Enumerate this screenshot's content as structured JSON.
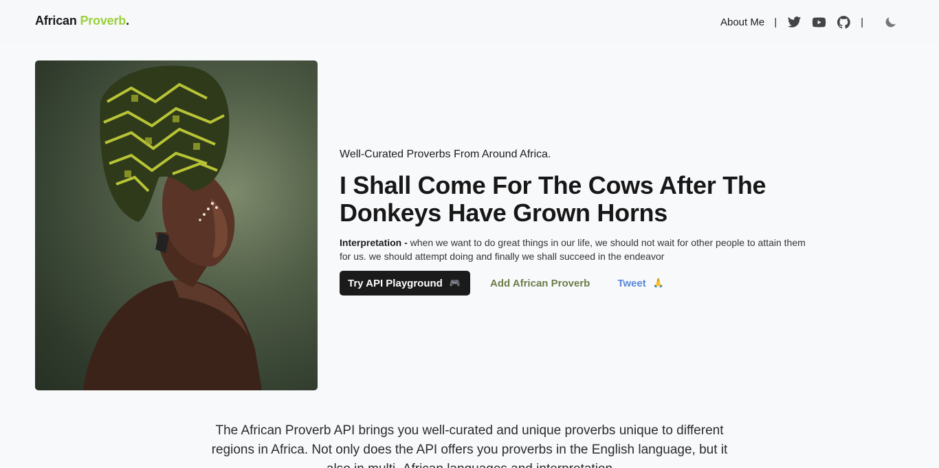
{
  "header": {
    "logo": {
      "part1": "African",
      "part2": "Proverb",
      "part3": "."
    },
    "nav": {
      "about_label": "About Me",
      "separator": "|",
      "icons": [
        "twitter-icon",
        "youtube-icon",
        "github-icon",
        "moon-icon"
      ]
    }
  },
  "hero": {
    "tagline": "Well-Curated Proverbs From Around Africa.",
    "proverb": "I Shall Come For The Cows After The Donkeys Have Grown Horns",
    "interpretation_label": "Interpretation -",
    "interpretation_text": "when we want to do great things in our life, we should not wait for other people to attain them for us. we should attempt doing and finally we shall succeed in the endeavor",
    "buttons": {
      "playground_label": "Try API Playground",
      "playground_emoji": "🎮",
      "add_label": "Add African Proverb",
      "tweet_label": "Tweet",
      "tweet_emoji": "🙏"
    }
  },
  "description": "The African Proverb API brings you well-curated and unique proverbs unique to different regions in Africa. Not only does the API offers you proverbs in the English language, but it also in multi- African languages and interpretation",
  "colors": {
    "accent": "#9ad13a",
    "add_link": "#6b7c47",
    "tweet_link": "#5a86d9",
    "primary_button": "#1b1b1b",
    "background": "#f8f9fb"
  }
}
